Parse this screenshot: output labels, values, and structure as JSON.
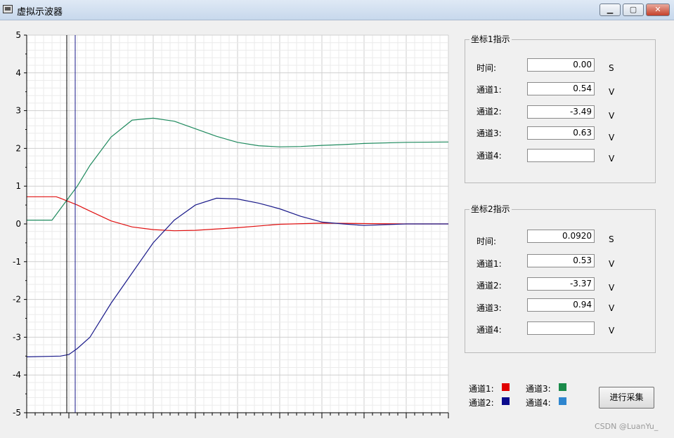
{
  "window": {
    "title": "虚拟示波器",
    "minimize": "▁",
    "maximize": "▢",
    "close": "✕"
  },
  "chart_data": {
    "type": "line",
    "xlim": [
      0,
      100
    ],
    "ylim": [
      -5,
      5
    ],
    "y_ticks": [
      "5",
      "4",
      "3",
      "2",
      "1",
      "0",
      "-1",
      "-2",
      "-3",
      "-4",
      "-5"
    ],
    "grid": true,
    "cursors": [
      9.5,
      11.5
    ],
    "series": [
      {
        "name": "通道1",
        "color": "#e01010",
        "x": [
          0,
          7,
          8,
          12,
          15,
          20,
          25,
          30,
          35,
          40,
          50,
          60,
          70,
          80,
          90,
          100
        ],
        "y": [
          0.72,
          0.72,
          0.68,
          0.5,
          0.34,
          0.08,
          -0.08,
          -0.15,
          -0.18,
          -0.17,
          -0.1,
          -0.01,
          0.02,
          0.01,
          0.0,
          0.0
        ]
      },
      {
        "name": "通道2",
        "color": "#1a1a8a",
        "x": [
          0,
          8,
          10,
          12,
          15,
          20,
          25,
          30,
          35,
          40,
          45,
          50,
          55,
          60,
          65,
          70,
          75,
          80,
          90,
          100
        ],
        "y": [
          -3.52,
          -3.5,
          -3.46,
          -3.3,
          -3.0,
          -2.1,
          -1.3,
          -0.5,
          0.1,
          0.5,
          0.68,
          0.66,
          0.55,
          0.4,
          0.2,
          0.05,
          0.0,
          -0.04,
          0.0,
          0.0
        ]
      },
      {
        "name": "通道3",
        "color": "#1f8a5e",
        "x": [
          0,
          6,
          9,
          12,
          15,
          20,
          25,
          30,
          35,
          40,
          45,
          50,
          55,
          60,
          65,
          70,
          75,
          80,
          90,
          100
        ],
        "y": [
          0.1,
          0.1,
          0.55,
          1.0,
          1.55,
          2.3,
          2.75,
          2.8,
          2.72,
          2.52,
          2.32,
          2.16,
          2.07,
          2.04,
          2.05,
          2.08,
          2.1,
          2.13,
          2.16,
          2.17
        ]
      },
      {
        "name": "通道4",
        "color": "#3a8fd0",
        "x": [],
        "y": []
      }
    ]
  },
  "panel1": {
    "title": "坐标1指示",
    "rows": [
      {
        "label": "时间:",
        "value": "0.00",
        "unit": "S"
      },
      {
        "label": "通道1:",
        "value": "0.54",
        "unit": "V"
      },
      {
        "label": "通道2:",
        "value": "-3.49",
        "unit": "V"
      },
      {
        "label": "通道3:",
        "value": "0.63",
        "unit": "V"
      },
      {
        "label": "通道4:",
        "value": "",
        "unit": "V"
      }
    ]
  },
  "panel2": {
    "title": "坐标2指示",
    "rows": [
      {
        "label": "时间:",
        "value": "0.0920",
        "unit": "S"
      },
      {
        "label": "通道1:",
        "value": "0.53",
        "unit": "V"
      },
      {
        "label": "通道2:",
        "value": "-3.37",
        "unit": "V"
      },
      {
        "label": "通道3:",
        "value": "0.94",
        "unit": "V"
      },
      {
        "label": "通道4:",
        "value": "",
        "unit": "V"
      }
    ]
  },
  "legend": [
    {
      "label": "通道1:",
      "color": "#e00000"
    },
    {
      "label": "通道2:",
      "color": "#0a0a8c"
    },
    {
      "label": "通道3:",
      "color": "#1a8a4a"
    },
    {
      "label": "通道4:",
      "color": "#2e86cf"
    }
  ],
  "collect_button": "进行采集",
  "watermark": "CSDN @LuanYu_"
}
